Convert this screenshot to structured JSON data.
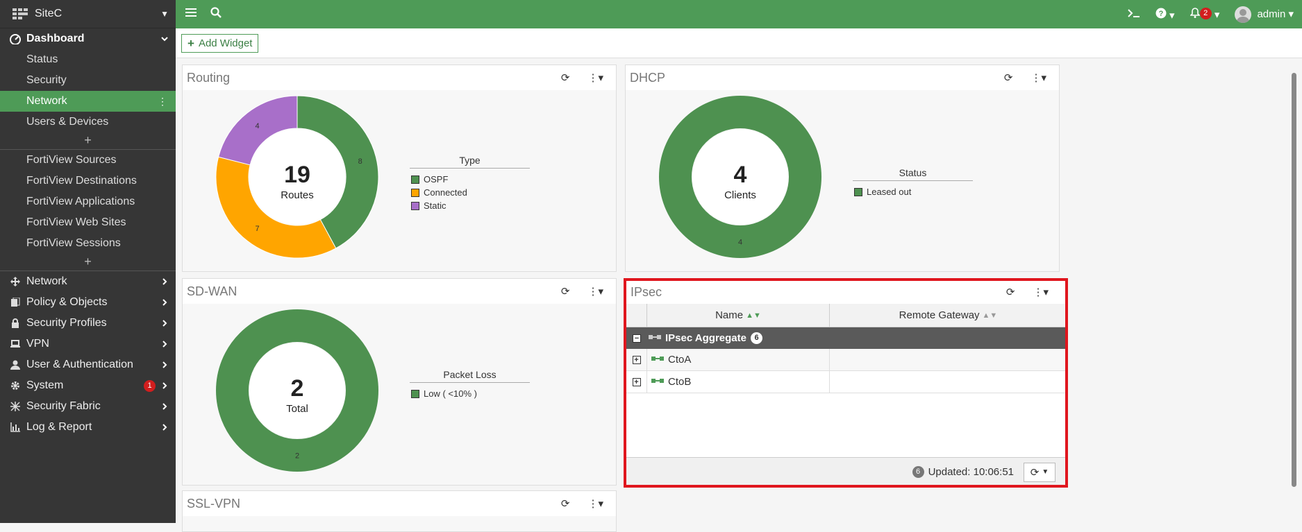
{
  "sidebar": {
    "site_name": "SiteC",
    "dashboard_label": "Dashboard",
    "dashboard_items": [
      "Status",
      "Security",
      "Network",
      "Users & Devices"
    ],
    "fortiview_items": [
      "FortiView Sources",
      "FortiView Destinations",
      "FortiView Applications",
      "FortiView Web Sites",
      "FortiView Sessions"
    ],
    "plus": "+",
    "menu": [
      {
        "label": "Network",
        "icon": "network-icon"
      },
      {
        "label": "Policy & Objects",
        "icon": "policy-icon"
      },
      {
        "label": "Security Profiles",
        "icon": "lock-icon"
      },
      {
        "label": "VPN",
        "icon": "laptop-icon"
      },
      {
        "label": "User & Authentication",
        "icon": "user-icon"
      },
      {
        "label": "System",
        "icon": "gear-icon",
        "badge": "1"
      },
      {
        "label": "Security Fabric",
        "icon": "fabric-icon"
      },
      {
        "label": "Log & Report",
        "icon": "chart-icon"
      }
    ]
  },
  "topbar": {
    "notifications": "2",
    "user": "admin"
  },
  "toolbar": {
    "add_widget": "Add Widget"
  },
  "widgets": {
    "routing": {
      "title": "Routing",
      "center_value": "19",
      "center_label": "Routes",
      "legend_title": "Type",
      "legend": [
        "OSPF",
        "Connected",
        "Static"
      ]
    },
    "dhcp": {
      "title": "DHCP",
      "center_value": "4",
      "center_label": "Clients",
      "legend_title": "Status",
      "legend": [
        "Leased out"
      ]
    },
    "sdwan": {
      "title": "SD-WAN",
      "center_value": "2",
      "center_label": "Total",
      "legend_title": "Packet Loss",
      "legend": [
        "Low ( <10% )"
      ]
    },
    "ipsec": {
      "title": "IPsec",
      "col_name": "Name",
      "col_gateway": "Remote Gateway",
      "aggregate": "IPsec Aggregate",
      "aggregate_count": "6",
      "rows": [
        "CtoA",
        "CtoB"
      ],
      "footer_count": "6",
      "updated": "Updated: 10:06:51"
    },
    "sslvpn": {
      "title": "SSL-VPN"
    }
  },
  "colors": {
    "green": "#4e9b57",
    "orange": "#ffa500",
    "purple": "#a86fc9",
    "chart_green": "#4e9150"
  },
  "chart_data": [
    {
      "type": "pie",
      "title": "Routing",
      "categories": [
        "OSPF",
        "Connected",
        "Static"
      ],
      "values": [
        8,
        7,
        4
      ],
      "colors": [
        "#4e9150",
        "#ffa500",
        "#a86fc9"
      ]
    },
    {
      "type": "pie",
      "title": "DHCP",
      "categories": [
        "Leased out"
      ],
      "values": [
        4
      ],
      "colors": [
        "#4e9150"
      ]
    },
    {
      "type": "pie",
      "title": "SD-WAN",
      "categories": [
        "Low ( <10% )"
      ],
      "values": [
        2
      ],
      "colors": [
        "#4e9150"
      ]
    }
  ]
}
